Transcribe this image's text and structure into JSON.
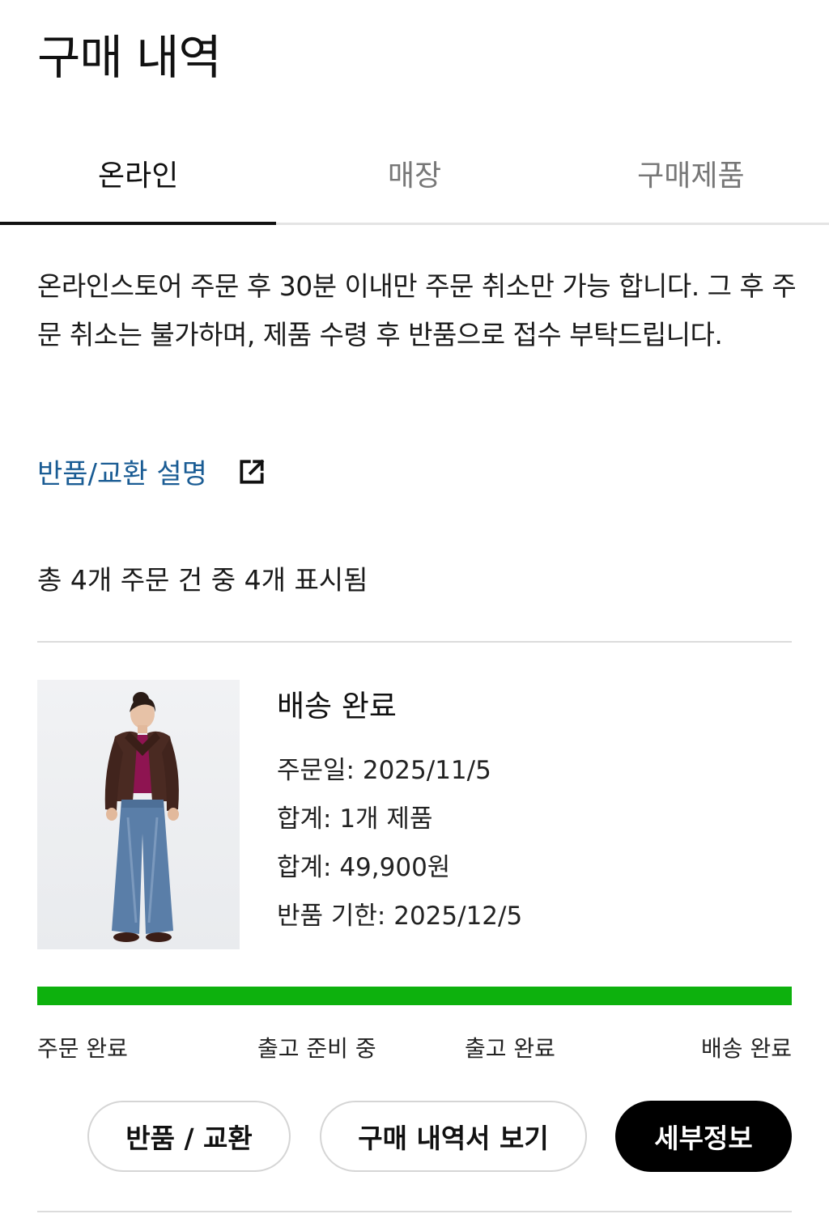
{
  "header": {
    "title": "구매 내역"
  },
  "tabs": [
    {
      "label": "온라인",
      "active": true
    },
    {
      "label": "매장",
      "active": false
    },
    {
      "label": "구매제품",
      "active": false
    }
  ],
  "notice": {
    "text": "온라인스토어 주문 후 30분 이내만 주문 취소만 가능 합니다. 그 후 주문 취소는 불가하며, 제품 수령 후 반품으로 접수 부탁드립니다."
  },
  "return_link": {
    "label": "반품/교환 설명",
    "icon": "external-link-icon"
  },
  "order_count": "총 4개 주문 건 중 4개 표시됨",
  "order": {
    "status": "배송 완료",
    "order_date": "주문일: 2025/11/5",
    "item_total": "합계: 1개 제품",
    "price_total": "합계: 49,900원",
    "return_deadline": "반품 기한: 2025/12/5",
    "progress": 1.0,
    "progress_color": "#0db10d",
    "steps": [
      "주문 완료",
      "출고 준비 중",
      "출고 완료",
      "배송 완료"
    ],
    "buttons": {
      "return_exchange": "반품 / 교환",
      "receipt": "구매 내역서 보기",
      "details": "세부정보"
    }
  },
  "colors": {
    "link": "#1a5c94",
    "progress": "#0db10d",
    "primary_button": "#000000"
  }
}
